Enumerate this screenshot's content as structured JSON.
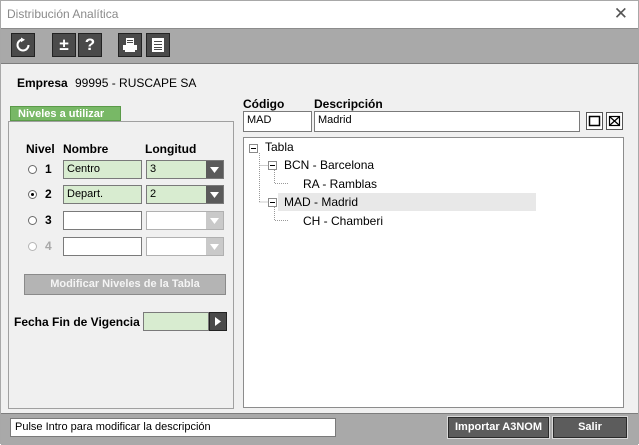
{
  "window": {
    "title": "Distribución Analítica"
  },
  "toolbar": {
    "buttons": [
      {
        "icon": "refresh-icon"
      },
      {
        "icon": "plus-minus-icon",
        "glyph": "±"
      },
      {
        "icon": "help-icon",
        "glyph": "?"
      },
      {
        "icon": "printer-icon"
      },
      {
        "icon": "list-icon"
      }
    ]
  },
  "empresa": {
    "label": "Empresa",
    "value": "99995 - RUSCAPE SA"
  },
  "niveles": {
    "tab_label": "Niveles a utilizar",
    "headers": {
      "nivel": "Nivel",
      "nombre": "Nombre",
      "longitud": "Longitud"
    },
    "rows": [
      {
        "number": "1",
        "name": "Centro",
        "length": "3",
        "checked": false,
        "enabled": true
      },
      {
        "number": "2",
        "name": "Depart.",
        "length": "2",
        "checked": true,
        "enabled": true
      },
      {
        "number": "3",
        "name": "",
        "length": "",
        "checked": false,
        "enabled": true
      },
      {
        "number": "4",
        "name": "",
        "length": "",
        "checked": false,
        "enabled": false
      }
    ],
    "modify_button": "Modificar Niveles de la Tabla"
  },
  "fecha": {
    "label": "Fecha Fin de Vigencia",
    "value": ""
  },
  "codigo": {
    "label": "Código",
    "value": "MAD"
  },
  "descripcion": {
    "label": "Descripción",
    "value": "Madrid"
  },
  "tree": {
    "root": "Tabla",
    "nodes": [
      {
        "code": "BCN",
        "label": "BCN - Barcelona",
        "children": [
          {
            "label": "RA - Ramblas"
          }
        ]
      },
      {
        "code": "MAD",
        "label": "MAD - Madrid",
        "selected": true,
        "children": [
          {
            "label": "CH - Chamberi"
          }
        ]
      }
    ]
  },
  "status": {
    "message": "Pulse Intro para modificar la descripción",
    "import_button": "Importar A3NOM",
    "exit_button": "Salir"
  },
  "colors": {
    "tab_green": "#78b866",
    "field_green": "#d8ecd0",
    "toolbar_gray": "#a9a9a9",
    "selected_row": "#e8e8e8"
  }
}
